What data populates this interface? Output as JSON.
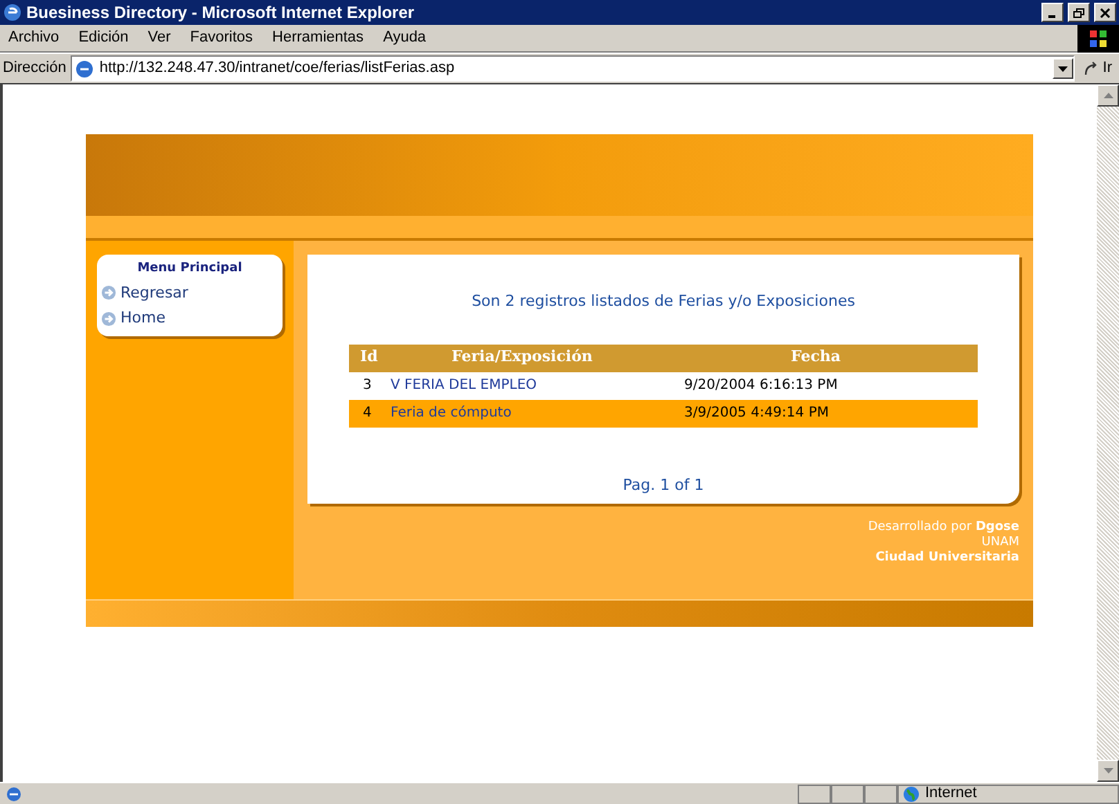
{
  "window": {
    "title": "Buesiness Directory - Microsoft Internet Explorer"
  },
  "menu_bar": [
    "Archivo",
    "Edición",
    "Ver",
    "Favoritos",
    "Herramientas",
    "Ayuda"
  ],
  "address_bar": {
    "label": "Dirección",
    "value": "http://132.248.47.30/intranet/coe/ferias/listFerias.asp",
    "go": "Ir"
  },
  "page": {
    "side_menu": {
      "title": "Menu Principal",
      "items": [
        "Regresar",
        "Home"
      ]
    },
    "summary": "Son 2 registros listados de Ferias y/o Exposiciones",
    "table": {
      "columns": [
        "Id",
        "Feria/Exposición",
        "Fecha"
      ],
      "rows": [
        {
          "id": "3",
          "name": "V FERIA DEL EMPLEO",
          "date": "9/20/2004 6:16:13 PM",
          "selected": false
        },
        {
          "id": "4",
          "name": "Feria de cómputo",
          "date": "3/9/2005 4:49:14 PM",
          "selected": true
        }
      ]
    },
    "pagination": "Pag. 1 of 1",
    "footer": [
      "Desarrollado por **Dgose**",
      "UNAM",
      "Ciudad Universitaria"
    ]
  },
  "status_bar": {
    "zone": "Internet"
  }
}
